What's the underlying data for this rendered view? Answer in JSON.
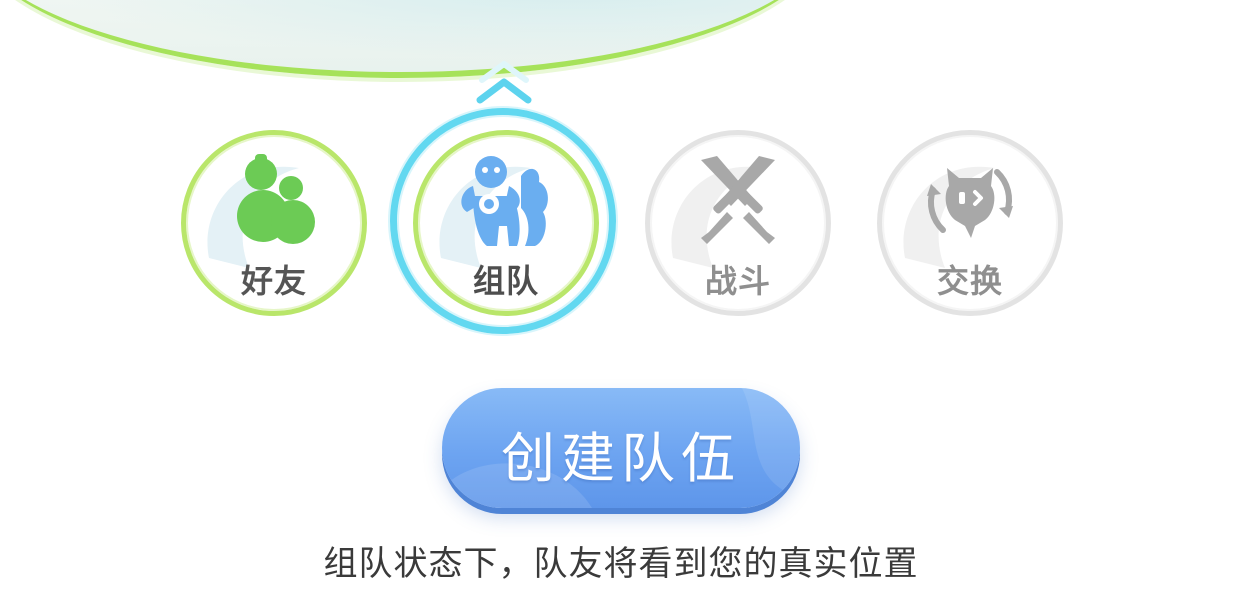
{
  "features": [
    {
      "id": "friends",
      "label": "好友",
      "icon": "gourd-icon",
      "state": "available",
      "color": "#6ccb55"
    },
    {
      "id": "team",
      "label": "组队",
      "icon": "team-pet-icon",
      "state": "selected",
      "color": "#6aaef0"
    },
    {
      "id": "battle",
      "label": "战斗",
      "icon": "crossed-swords-icon",
      "state": "inactive",
      "color": "#a8a8a8"
    },
    {
      "id": "exchange",
      "label": "交换",
      "icon": "exchange-cycle-icon",
      "state": "inactive",
      "color": "#a8a8a8"
    }
  ],
  "create_button": {
    "label": "创建队伍"
  },
  "hint_text": "组队状态下，队友将看到您的真实位置",
  "colors": {
    "selected_ring": "#62d8f0",
    "active_ring": "#b9e66a",
    "button": "#6da4f1"
  }
}
